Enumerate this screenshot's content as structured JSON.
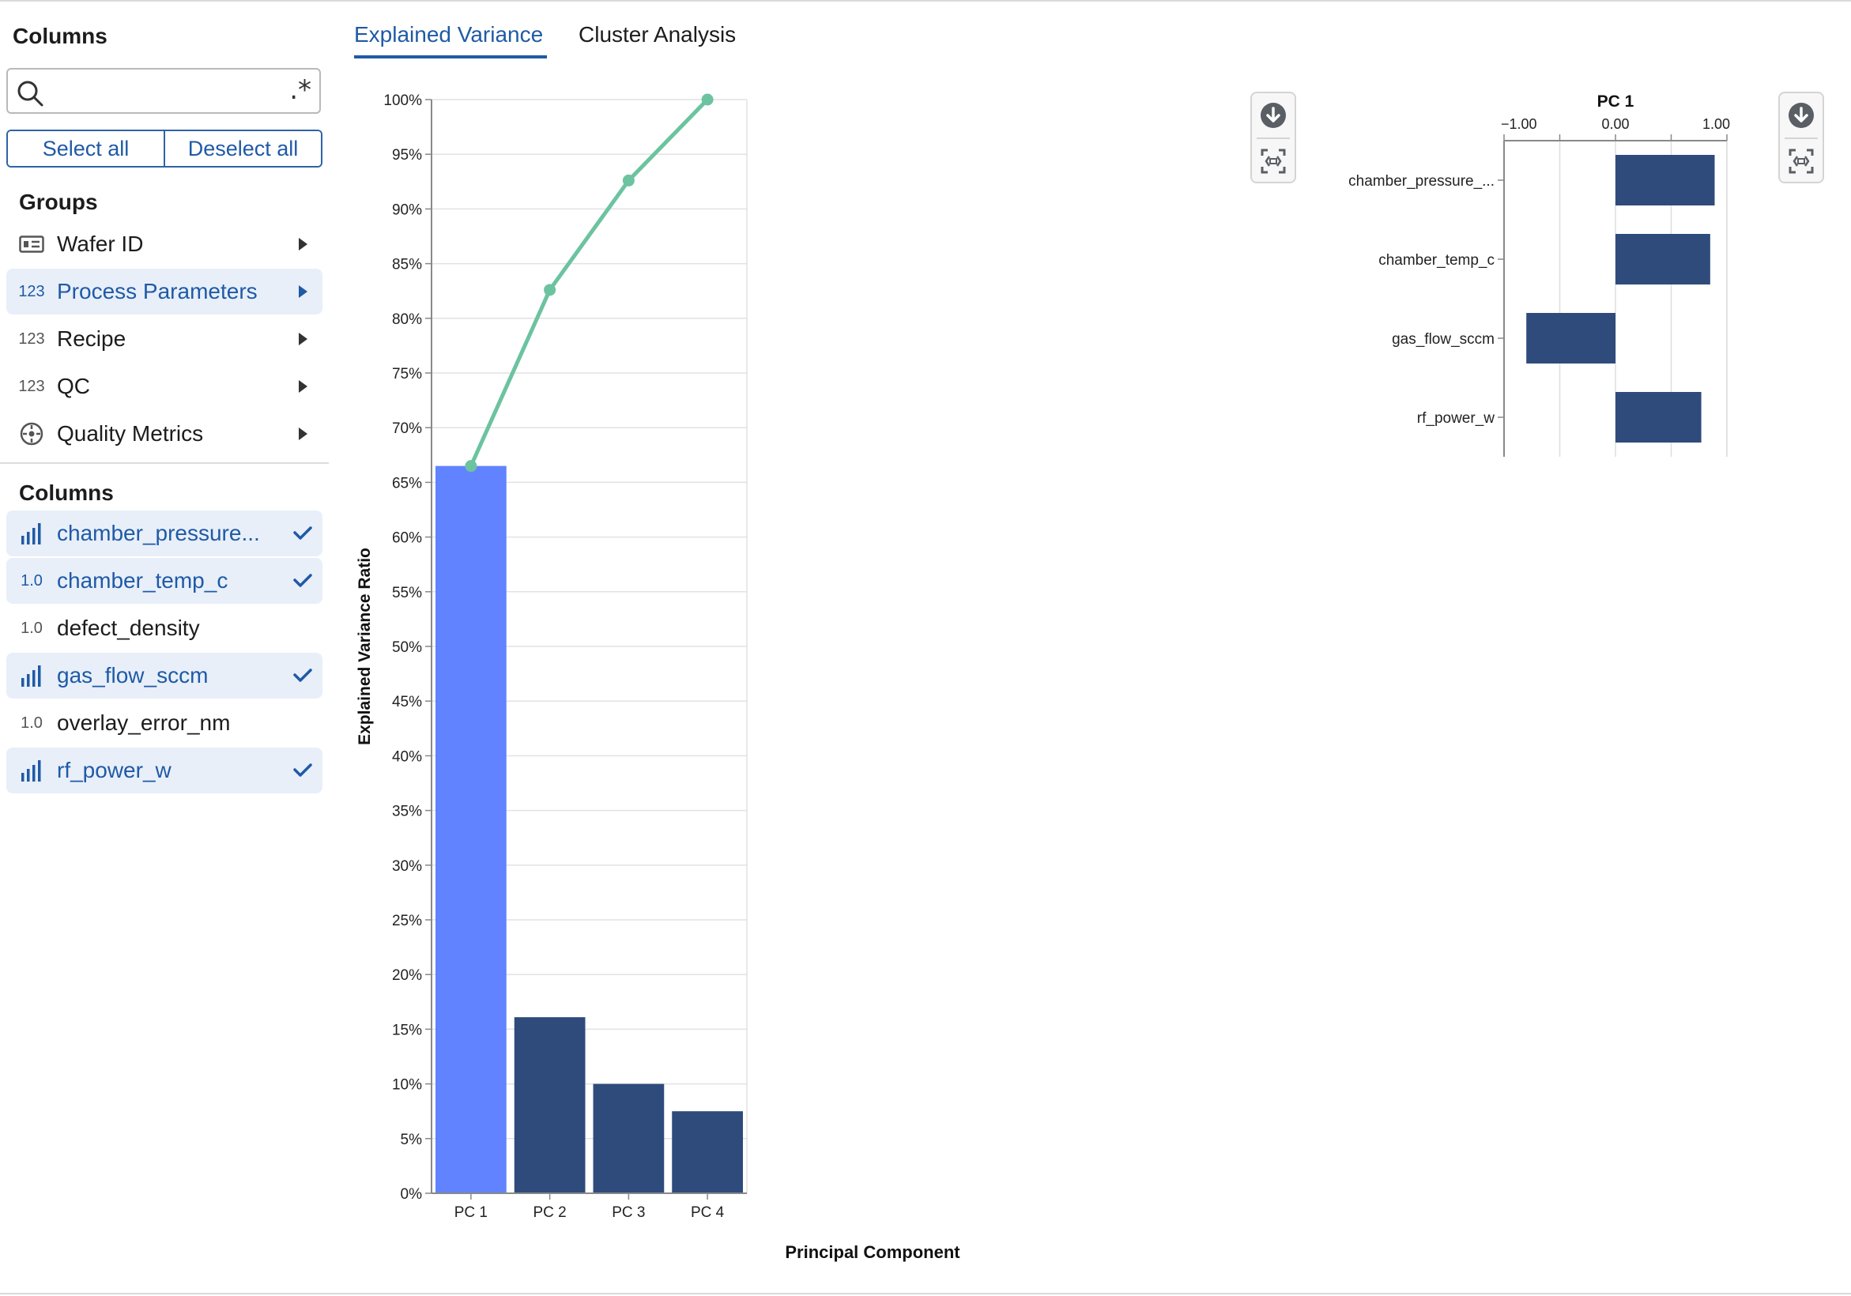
{
  "sidebar": {
    "heading": "Columns",
    "search": {
      "placeholder": "",
      "regex_symbol": ".*"
    },
    "select_all": "Select all",
    "deselect_all": "Deselect all",
    "groups_title": "Groups",
    "groups": [
      {
        "icon": "id-card-icon",
        "label": "Wafer ID",
        "active": false
      },
      {
        "icon": "123",
        "label": "Process Parameters",
        "active": true
      },
      {
        "icon": "123",
        "label": "Recipe",
        "active": false
      },
      {
        "icon": "123",
        "label": "QC",
        "active": false
      },
      {
        "icon": "target-icon",
        "label": "Quality Metrics",
        "active": false
      }
    ],
    "columns_title": "Columns",
    "columns": [
      {
        "icon": "bar-chart-icon",
        "label": "chamber_pressure...",
        "selected": true
      },
      {
        "icon": "1.0",
        "label": "chamber_temp_c",
        "selected": true
      },
      {
        "icon": "1.0",
        "label": "defect_density",
        "selected": false
      },
      {
        "icon": "bar-chart-icon",
        "label": "gas_flow_sccm",
        "selected": true
      },
      {
        "icon": "1.0",
        "label": "overlay_error_nm",
        "selected": false
      },
      {
        "icon": "bar-chart-icon",
        "label": "rf_power_w",
        "selected": true
      }
    ]
  },
  "tabs": [
    {
      "label": "Explained Variance",
      "active": true
    },
    {
      "label": "Cluster Analysis",
      "active": false
    }
  ],
  "colors": {
    "accent": "#1f5aa6",
    "bar": "#2f4b7c",
    "bar_highlight": "#6283ff",
    "cumulative_line": "#6cc3a0"
  },
  "chart_data": [
    {
      "type": "bar",
      "xlabel": "Principal Component",
      "ylabel": "Explained Variance Ratio",
      "categories": [
        "PC 1",
        "PC 2",
        "PC 3",
        "PC 4"
      ],
      "values": [
        0.665,
        0.161,
        0.1,
        0.075
      ],
      "cumulative": [
        0.665,
        0.826,
        0.926,
        1.0
      ],
      "ylim": [
        0,
        1
      ],
      "yticks": [
        0,
        0.05,
        0.1,
        0.15,
        0.2,
        0.25,
        0.3,
        0.35,
        0.4,
        0.45,
        0.5,
        0.55,
        0.6,
        0.65,
        0.7,
        0.75,
        0.8,
        0.85,
        0.9,
        0.95,
        1.0
      ],
      "ytick_labels": [
        "0%",
        "5%",
        "10%",
        "15%",
        "20%",
        "25%",
        "30%",
        "35%",
        "40%",
        "45%",
        "50%",
        "55%",
        "60%",
        "65%",
        "70%",
        "75%",
        "80%",
        "85%",
        "90%",
        "95%",
        "100%"
      ],
      "grid": true
    },
    {
      "type": "bar",
      "orientation": "horizontal",
      "title": "PC 1",
      "categories": [
        "chamber_pressure_...",
        "chamber_temp_c",
        "gas_flow_sccm",
        "rf_power_w"
      ],
      "values": [
        0.89,
        0.85,
        -0.8,
        0.77
      ],
      "xlim": [
        -1.0,
        1.0
      ],
      "xticks": [
        -1.0,
        0.0,
        1.0
      ],
      "xtick_labels": [
        "−1.00",
        "0.00",
        "1.00"
      ],
      "grid": true
    }
  ]
}
